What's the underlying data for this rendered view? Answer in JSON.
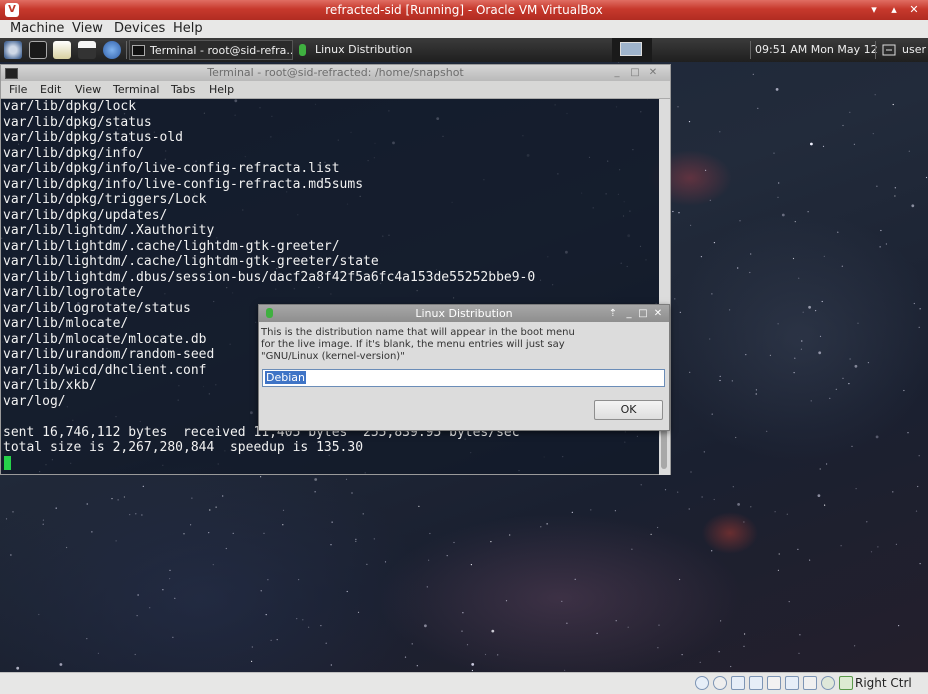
{
  "host_window": {
    "title": "refracted-sid [Running] - Oracle VM VirtualBox",
    "app_icon_letter": "V",
    "controls": {
      "minimize": "▾",
      "restore": "▴",
      "close": "✕"
    },
    "menu": [
      "Machine",
      "View",
      "Devices",
      "Help"
    ]
  },
  "taskbar": {
    "launchers": [
      "apps-menu-icon",
      "terminal-icon",
      "text-editor-icon",
      "file-manager-icon",
      "web-browser-icon"
    ],
    "tasks": [
      {
        "label": "Terminal - root@sid-refra...",
        "icon": "terminal-icon"
      },
      {
        "label": "Linux Distribution",
        "icon": "app-icon"
      }
    ],
    "workspace_icon": "desktop-pager-icon",
    "clock": "09:51 AM Mon May 12",
    "user": "user",
    "logout_icon": "logout-icon"
  },
  "terminal": {
    "title": "Terminal - root@sid-refracted: /home/snapshot",
    "menu": [
      "File",
      "Edit",
      "View",
      "Terminal",
      "Tabs",
      "Help"
    ],
    "controls": {
      "minimize": "_",
      "maximize": "□",
      "close": "✕"
    },
    "lines": [
      "var/lib/dpkg/lock",
      "var/lib/dpkg/status",
      "var/lib/dpkg/status-old",
      "var/lib/dpkg/info/",
      "var/lib/dpkg/info/live-config-refracta.list",
      "var/lib/dpkg/info/live-config-refracta.md5sums",
      "var/lib/dpkg/triggers/Lock",
      "var/lib/dpkg/updates/",
      "var/lib/lightdm/.Xauthority",
      "var/lib/lightdm/.cache/lightdm-gtk-greeter/",
      "var/lib/lightdm/.cache/lightdm-gtk-greeter/state",
      "var/lib/lightdm/.dbus/session-bus/dacf2a8f42f5a6fc4a153de55252bbe9-0",
      "var/lib/logrotate/",
      "var/lib/logrotate/status",
      "var/lib/mlocate/",
      "var/lib/mlocate/mlocate.db",
      "var/lib/urandom/random-seed",
      "var/lib/wicd/dhclient.conf",
      "var/lib/xkb/",
      "var/log/",
      "",
      "sent 16,746,112 bytes  received 11,405 bytes  255,839.95 bytes/sec",
      "total size is 2,267,280,844  speedup is 135.30"
    ]
  },
  "dialog": {
    "title": "Linux Distribution",
    "message": [
      "This is the distribution name that will appear in the boot menu",
      "for the live image. If it's blank, the menu entries will just say",
      "\"GNU/Linux (kernel-version)\""
    ],
    "input_value": "Debian",
    "ok_label": "OK",
    "controls": {
      "up": "⇡",
      "minimize": "_",
      "maximize": "□",
      "close": "✕"
    }
  },
  "statusbar": {
    "icons": [
      "hard-disk-icon",
      "optical-drive-icon",
      "usb-icon",
      "shared-folders-icon",
      "display-icon",
      "network-icon",
      "video-capture-icon",
      "cpu-icon",
      "mouse-integration-icon",
      "host-key-icon"
    ],
    "host_key": "Right Ctrl"
  }
}
